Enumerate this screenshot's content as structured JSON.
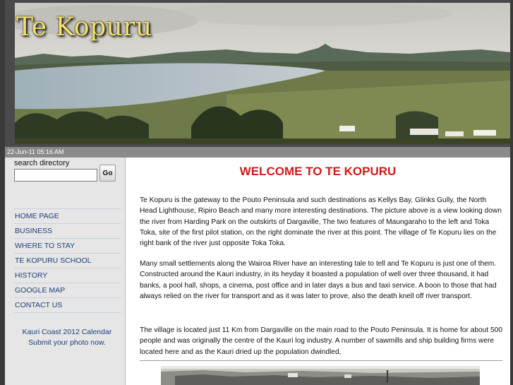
{
  "site": {
    "title": "Te Kopuru",
    "datetime": "22-Jun-11 05:16 AM"
  },
  "search": {
    "label": "search directory",
    "value": "",
    "placeholder": "",
    "button": "Go"
  },
  "nav": {
    "items": [
      {
        "label": "HOME PAGE"
      },
      {
        "label": "BUSINESS"
      },
      {
        "label": "WHERE TO STAY"
      },
      {
        "label": "TE KOPURU SCHOOL"
      },
      {
        "label": "HISTORY"
      },
      {
        "label": "GOOGLE MAP"
      },
      {
        "label": "CONTACT US"
      }
    ]
  },
  "promo": {
    "line1": "Kauri Coast 2012 Calendar",
    "line2": "Submit your photo now."
  },
  "main": {
    "heading": "WELCOME TO TE KOPURU",
    "paragraphs": [
      "Te Kopuru is the gateway to the Pouto Peninsula and such destinations as Kellys Bay, Glinks Gully, the North Head Lighthouse, Ripiro Beach and many more interesting destinations. The picture above is a view looking down the river from Harding Park on the outskirts of Dargaville, The two features of Maungaraho to the left and Toka Toka, site of the first pilot station, on the right dominate the river at this point. The village of Te Kopuru lies on the right bank of the river just opposite Toka Toka.",
      "Many small settlements along the Wairoa River have an interesting tale to tell and Te Kopuru is just one of them. Constructed around the Kauri industry, in its heyday it boasted a population of well over three thousand, it had banks, a pool hall, shops, a cinema, post office and in later days a bus and taxi service. A boon to those that had always relied on the river for transport and as it was later to prove, also the death knell off river transport.",
      "The village is located just 11 Km from Dargaville on the main road to the Pouto Peninsula. It is home for about 500 people and was originally the centre of the Kauri log industry. A number of sawmills and ship building firms were located here and as the Kauri dried up the population dwindled,"
    ]
  },
  "colors": {
    "heading": "#d01a1a",
    "nav_link": "#1d3f7a",
    "title": "#f3e26a",
    "sidebar_bg": "#e6e6e6",
    "header_bg": "#4a4a4a"
  }
}
